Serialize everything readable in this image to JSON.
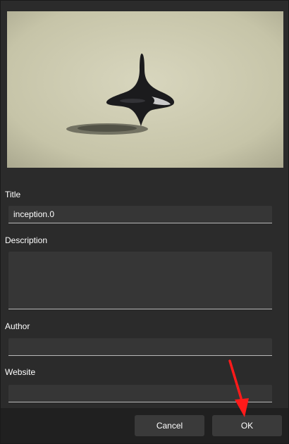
{
  "preview": {
    "alt": "spinning top"
  },
  "form": {
    "title_label": "Title",
    "title_value": "inception.0",
    "description_label": "Description",
    "description_value": "",
    "author_label": "Author",
    "author_value": "",
    "website_label": "Website",
    "website_value": ""
  },
  "footer": {
    "cancel_label": "Cancel",
    "ok_label": "OK"
  },
  "colors": {
    "annotation_arrow": "#ff1a1a",
    "background": "#2b2b2b",
    "field": "#363636"
  }
}
